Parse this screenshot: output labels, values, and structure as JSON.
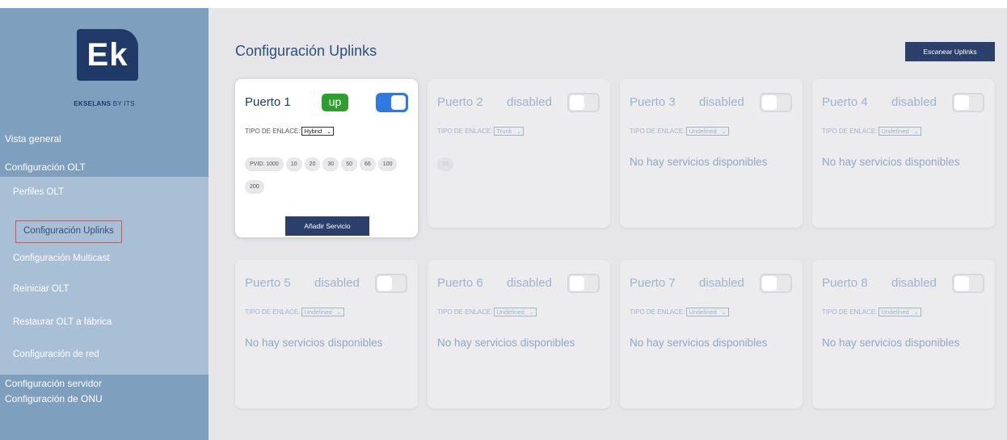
{
  "sidebar": {
    "logo_text": "Ek",
    "logo_sub_brand": "EKSELANS",
    "logo_sub_suffix": "BY ITS",
    "items": [
      {
        "label": "Vista general"
      },
      {
        "label": "Configuración OLT"
      },
      {
        "label": "Configuración servidor"
      },
      {
        "label": "Configuración de ONU"
      }
    ],
    "submenu": [
      {
        "label": "Perfiles OLT"
      },
      {
        "label": "Configuración Uplinks"
      },
      {
        "label": "Configuración Multicast"
      },
      {
        "label": "Reiniciar OLT"
      },
      {
        "label": "Restaurar OLT a fábrica"
      },
      {
        "label": "Configuración de red"
      }
    ]
  },
  "main": {
    "title": "Configuración Uplinks",
    "scan_button": "Escanear Uplinks",
    "link_type_label": "TIPO DE ENLACE:",
    "no_services": "No hay servicios disponibles",
    "add_service": "Añadir Servicio",
    "ports": [
      {
        "name": "Puerto 1",
        "status": "up",
        "enabled": true,
        "link_type": "Hybrid",
        "services": [
          "PVID: 1000",
          "10",
          "20",
          "30",
          "50",
          "66",
          "100",
          "200"
        ]
      },
      {
        "name": "Puerto 2",
        "status": "disabled",
        "enabled": false,
        "link_type": "Trunk",
        "services": [
          "10"
        ]
      },
      {
        "name": "Puerto 3",
        "status": "disabled",
        "enabled": false,
        "link_type": "Undefined",
        "services": []
      },
      {
        "name": "Puerto 4",
        "status": "disabled",
        "enabled": false,
        "link_type": "Undefined",
        "services": []
      },
      {
        "name": "Puerto 5",
        "status": "disabled",
        "enabled": false,
        "link_type": "Undefined",
        "services": []
      },
      {
        "name": "Puerto 6",
        "status": "disabled",
        "enabled": false,
        "link_type": "Undefined",
        "services": []
      },
      {
        "name": "Puerto 7",
        "status": "disabled",
        "enabled": false,
        "link_type": "Undefined",
        "services": []
      },
      {
        "name": "Puerto 8",
        "status": "disabled",
        "enabled": false,
        "link_type": "Undefined",
        "services": []
      }
    ]
  },
  "colors": {
    "sidebar": "#7f9fbf",
    "submenu": "#a9bfd6",
    "brand_dark": "#1f3a66",
    "status_up": "#2e9e2e",
    "toggle_on": "#2f7ae0",
    "active_outline": "#d9534f"
  }
}
